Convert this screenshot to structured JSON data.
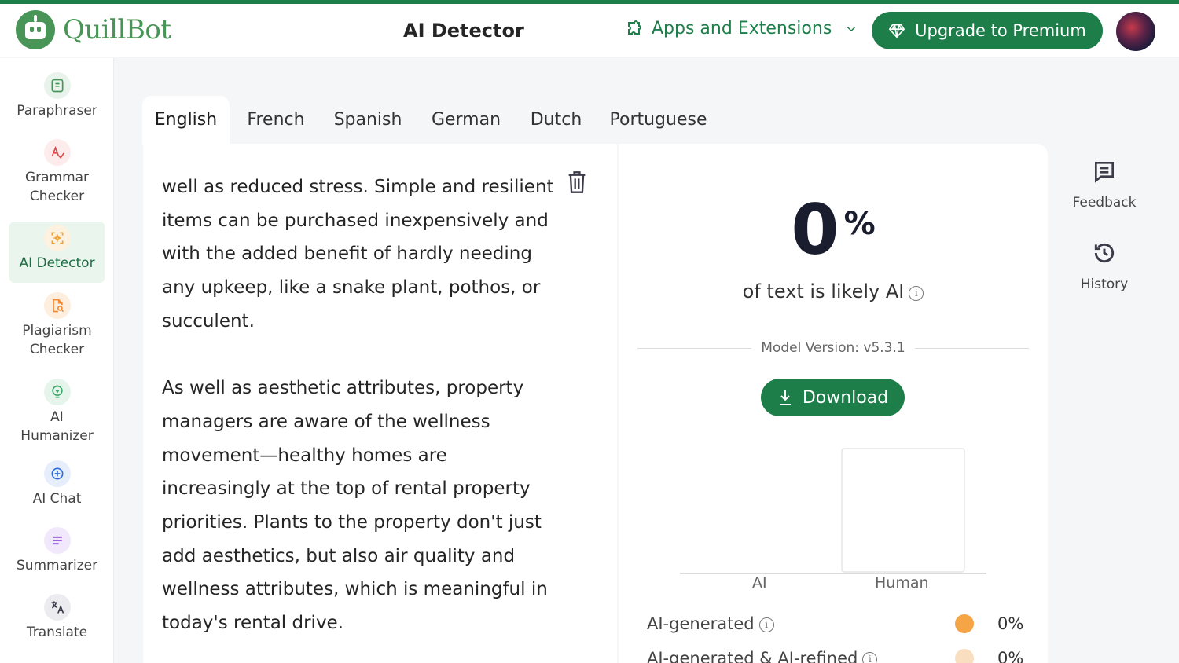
{
  "app": {
    "name": "QuillBot",
    "page_title": "AI Detector"
  },
  "header": {
    "apps_label": "Apps and Extensions",
    "upgrade_label": "Upgrade to Premium"
  },
  "sidebar": {
    "items": [
      {
        "label": "Paraphraser",
        "icon": "paraphraser-icon",
        "color": "#499557",
        "bg": "#e8f3ec"
      },
      {
        "label": "Grammar\nChecker",
        "icon": "grammar-checker-icon",
        "color": "#e5484d",
        "bg": "#fdecec"
      },
      {
        "label": "AI Detector",
        "icon": "ai-detector-icon",
        "color": "#f0a235",
        "bg": "#fdf1df"
      },
      {
        "label": "Plagiarism\nChecker",
        "icon": "plagiarism-checker-icon",
        "color": "#f08a35",
        "bg": "#fdeedd"
      },
      {
        "label": "AI\nHumanizer",
        "icon": "ai-humanizer-icon",
        "color": "#3da66a",
        "bg": "#e6f5ec"
      },
      {
        "label": "AI Chat",
        "icon": "ai-chat-icon",
        "color": "#2f6fdb",
        "bg": "#e6eefc"
      },
      {
        "label": "Summarizer",
        "icon": "summarizer-icon",
        "color": "#8a4fd6",
        "bg": "#f1e9fb"
      },
      {
        "label": "Translate",
        "icon": "translate-icon",
        "color": "#3b3b4a",
        "bg": "#ececf0"
      }
    ]
  },
  "tabs": [
    "English",
    "French",
    "Spanish",
    "German",
    "Dutch",
    "Portuguese"
  ],
  "editor": {
    "paragraphs": [
      "well as reduced stress. Simple and resilient items can be purchased inexpensively and with the added benefit of hardly needing any upkeep, like a snake plant, pothos, or succulent.",
      "As well as aesthetic attributes, property managers are aware of the wellness movement—healthy homes are increasingly at the top of rental property priorities. Plants to the property don't just add aesthetics, but also air quality and wellness attributes, which is meaningful in today's rental drive."
    ]
  },
  "results": {
    "percent_value": "0",
    "percent_sign": "%",
    "likely_text": "of text is likely AI",
    "model_version": "Model Version: v5.3.1",
    "download_label": "Download",
    "legend": [
      {
        "label": "AI-generated",
        "value": "0%",
        "color": "#f5a446"
      },
      {
        "label": "AI-generated & AI-refined",
        "value": "0%",
        "color": "#f9dfc0"
      }
    ]
  },
  "chart_data": {
    "type": "bar",
    "categories": [
      "AI",
      "Human"
    ],
    "values": [
      0,
      100
    ],
    "ylim": [
      0,
      100
    ]
  },
  "rightbar": {
    "feedback_label": "Feedback",
    "history_label": "History"
  },
  "colors": {
    "brand": "#1e7e4a",
    "logo": "#499557"
  }
}
